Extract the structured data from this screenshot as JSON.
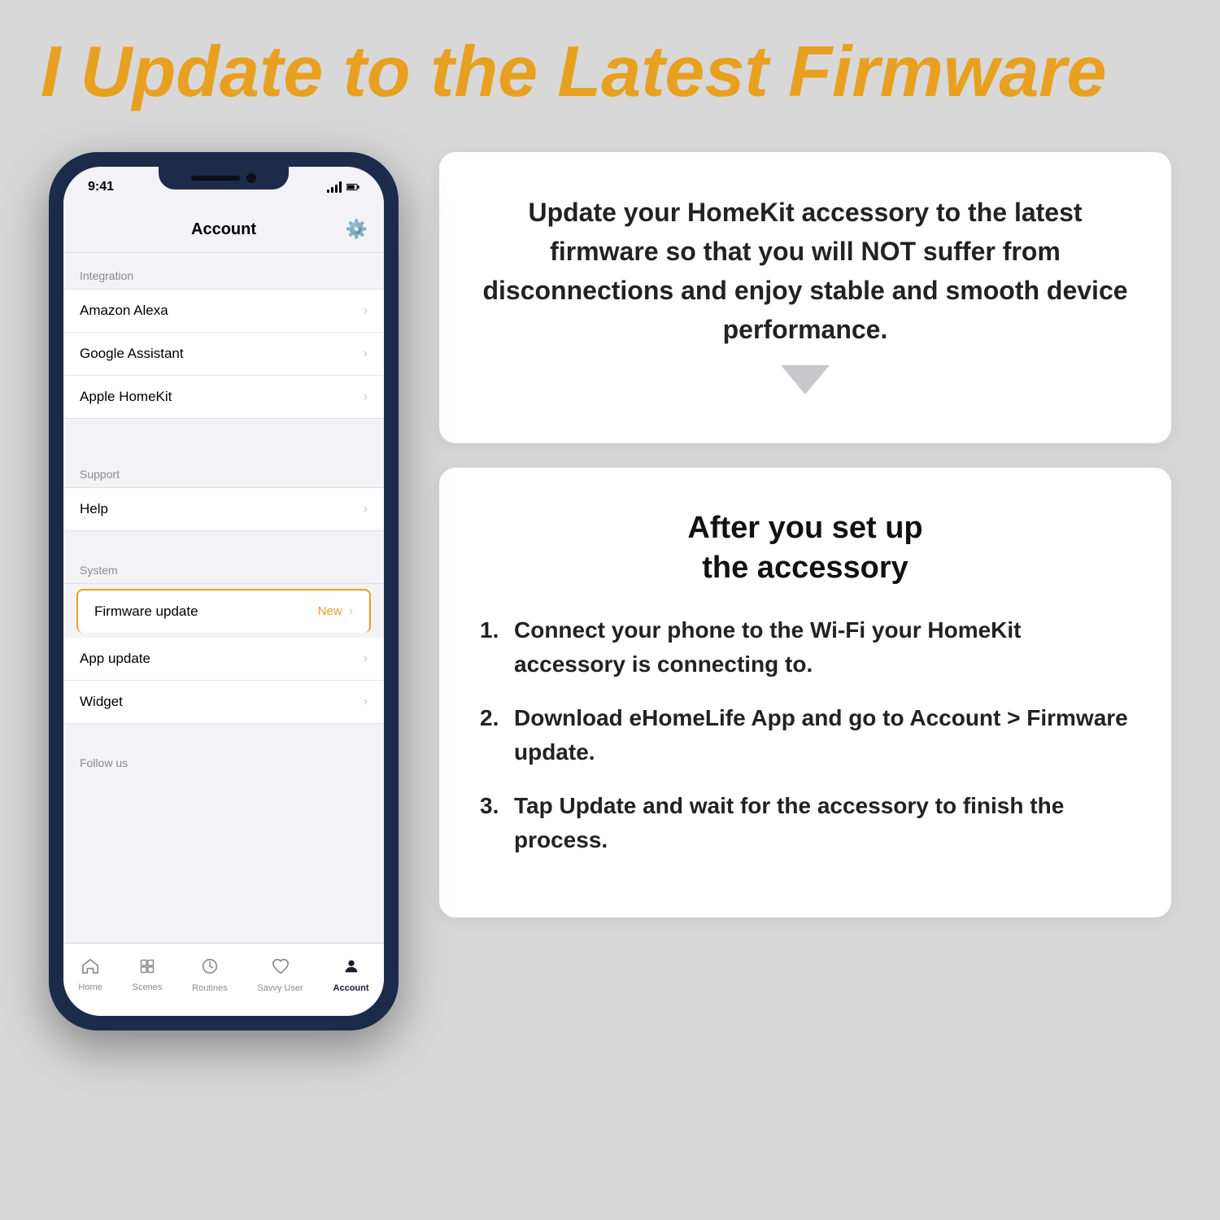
{
  "header": {
    "title": "I Update to the Latest Firmware"
  },
  "phone": {
    "screen_title": "Account",
    "sections": [
      {
        "label": "Integration",
        "items": [
          {
            "id": "amazon-alexa",
            "label": "Amazon Alexa",
            "badge": "",
            "highlighted": false
          },
          {
            "id": "google-assistant",
            "label": "Google Assistant",
            "badge": "",
            "highlighted": false
          },
          {
            "id": "apple-homekit",
            "label": "Apple HomeKit",
            "badge": "",
            "highlighted": false
          }
        ]
      },
      {
        "label": "Support",
        "items": [
          {
            "id": "help",
            "label": "Help",
            "badge": "",
            "highlighted": false
          }
        ]
      },
      {
        "label": "System",
        "items": [
          {
            "id": "firmware-update",
            "label": "Firmware update",
            "badge": "New",
            "highlighted": true
          },
          {
            "id": "app-update",
            "label": "App update",
            "badge": "",
            "highlighted": false
          },
          {
            "id": "widget",
            "label": "Widget",
            "badge": "",
            "highlighted": false
          }
        ]
      },
      {
        "label": "Follow us",
        "items": []
      }
    ],
    "tabs": [
      {
        "id": "home",
        "label": "Home",
        "icon": "🏠",
        "active": false
      },
      {
        "id": "scenes",
        "label": "Scenes",
        "icon": "🎬",
        "active": false
      },
      {
        "id": "routines",
        "label": "Routines",
        "icon": "⏰",
        "active": false
      },
      {
        "id": "savvy-user",
        "label": "Savvy User",
        "icon": "♡",
        "active": false
      },
      {
        "id": "account",
        "label": "Account",
        "icon": "👤",
        "active": true
      }
    ]
  },
  "info": {
    "description": "Update your HomeKit accessory to the latest firmware so that you will NOT suffer from disconnections and enjoy stable and smooth device performance.",
    "steps_title": "After you set up\nthe accessory",
    "steps": [
      "Connect your phone to the Wi-Fi your HomeKit accessory is connecting to.",
      "Download eHomeLife App and go to Account > Firmware update.",
      "Tap Update and wait for the accessory to finish the process."
    ]
  }
}
